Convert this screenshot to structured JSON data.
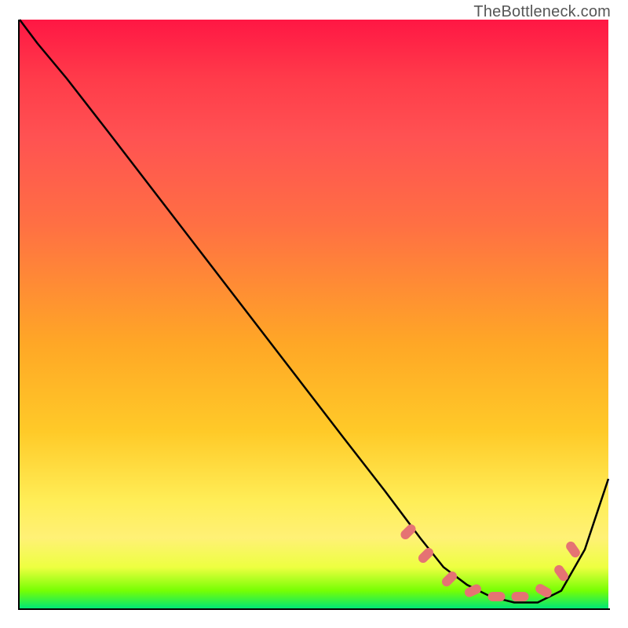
{
  "watermark": "TheBottleneck.com",
  "chart_data": {
    "type": "line",
    "title": "",
    "xlabel": "",
    "ylabel": "",
    "xlim": [
      0,
      100
    ],
    "ylim": [
      0,
      100
    ],
    "legend": false,
    "grid": false,
    "background_gradient": {
      "direction": "vertical",
      "stops": [
        {
          "pos": 0.0,
          "color": "#ff1744"
        },
        {
          "pos": 0.35,
          "color": "#ff7043"
        },
        {
          "pos": 0.7,
          "color": "#ffca28"
        },
        {
          "pos": 0.88,
          "color": "#fff176"
        },
        {
          "pos": 1.0,
          "color": "#00e676"
        }
      ]
    },
    "series": [
      {
        "name": "bottleneck-curve",
        "color": "#000000",
        "x": [
          0,
          3,
          8,
          15,
          25,
          35,
          45,
          55,
          62,
          68,
          72,
          76,
          80,
          84,
          88,
          92,
          96,
          100
        ],
        "y": [
          100,
          96,
          90,
          81,
          68,
          55,
          42,
          29,
          20,
          12,
          7,
          4,
          2,
          1,
          1,
          3,
          10,
          22
        ]
      }
    ],
    "markers": {
      "name": "optimal-zone",
      "color": "#e57373",
      "shape": "rounded-dash",
      "points": [
        {
          "x": 66,
          "y": 13
        },
        {
          "x": 69,
          "y": 9
        },
        {
          "x": 73,
          "y": 5
        },
        {
          "x": 77,
          "y": 3
        },
        {
          "x": 81,
          "y": 2
        },
        {
          "x": 85,
          "y": 2
        },
        {
          "x": 89,
          "y": 3
        },
        {
          "x": 92,
          "y": 6
        },
        {
          "x": 94,
          "y": 10
        }
      ]
    }
  }
}
